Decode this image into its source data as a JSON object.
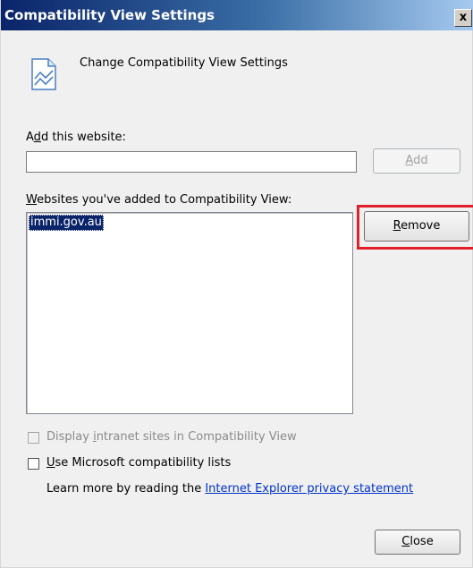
{
  "window": {
    "title": "Compatibility View Settings",
    "close_glyph": "x"
  },
  "header": {
    "icon": "compatibility-view-icon",
    "text": "Change Compatibility View Settings"
  },
  "add_section": {
    "label_prefix": "A",
    "label_accel": "d",
    "label_suffix": "d this website:",
    "input_value": "",
    "add_button_accel": "A",
    "add_button_rest": "dd"
  },
  "sites_section": {
    "label_accel": "W",
    "label_rest": "ebsites you've added to Compatibility View:",
    "items": [
      "immi.gov.au"
    ],
    "remove_button_accel": "R",
    "remove_button_rest": "emove"
  },
  "options": {
    "intranet_label_prefix": "Display ",
    "intranet_label_accel": "i",
    "intranet_label_suffix": "ntranet sites in Compatibility View",
    "intranet_checked": false,
    "ms_lists_label_accel": "U",
    "ms_lists_label_rest": "se Microsoft compatibility lists",
    "ms_lists_checked": false
  },
  "learn_more": {
    "prefix": "Learn more by reading the ",
    "link_text": "Internet Explorer privacy statement"
  },
  "footer": {
    "close_button_accel": "C",
    "close_button_rest": "lose"
  },
  "colors": {
    "highlight_annotation": "#e0202a",
    "selection": "#0a246a",
    "link": "#0033cc"
  }
}
